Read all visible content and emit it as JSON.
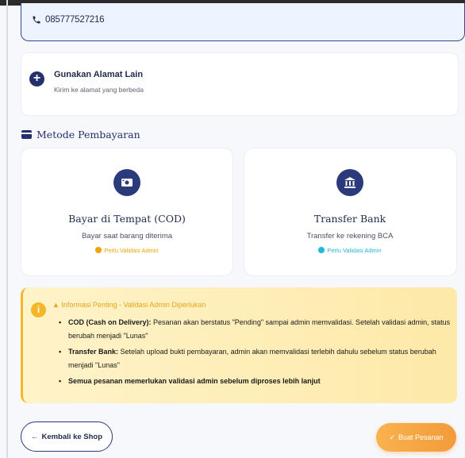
{
  "address": {
    "phone": "085777527216"
  },
  "alt_address": {
    "title": "Gunakan Alamat Lain",
    "subtitle": "Kirim ke alamat yang berbeda"
  },
  "payment_section": {
    "title": "Metode Pembayaran"
  },
  "payment_methods": [
    {
      "title": "Bayar di Tempat (COD)",
      "desc": "Bayar saat barang diterima",
      "badge": "Perlu Validasi Admin",
      "badge_color": "#f0a500",
      "icon": "money-icon"
    },
    {
      "title": "Transfer Bank",
      "desc": "Transfer ke rekening BCA",
      "badge": "Perlu Validasi Admin",
      "badge_color": "#22b8d6",
      "icon": "bank-icon"
    }
  ],
  "info": {
    "title": "Informasi Penting - Validasi Admin Diperlukan",
    "items": [
      {
        "bold": "COD (Cash on Delivery):",
        "text": " Pesanan akan berstatus \"Pending\" sampai admin memvalidasi. Setelah validasi admin, status berubah menjadi \"Lunas\""
      },
      {
        "bold": "Transfer Bank:",
        "text": " Setelah upload bukti pembayaran, admin akan memvalidasi terlebih dahulu sebelum status berubah menjadi \"Lunas\""
      },
      {
        "bold": "Semua pesanan memerlukan validasi admin sebelum diproses lebih lanjut",
        "text": ""
      }
    ]
  },
  "buttons": {
    "back": "Kembali ke Shop",
    "order": "Buat Pesanan"
  },
  "colors": {
    "primary": "#23306b",
    "warning": "#f5b728",
    "order_button": "#f39b3a"
  }
}
